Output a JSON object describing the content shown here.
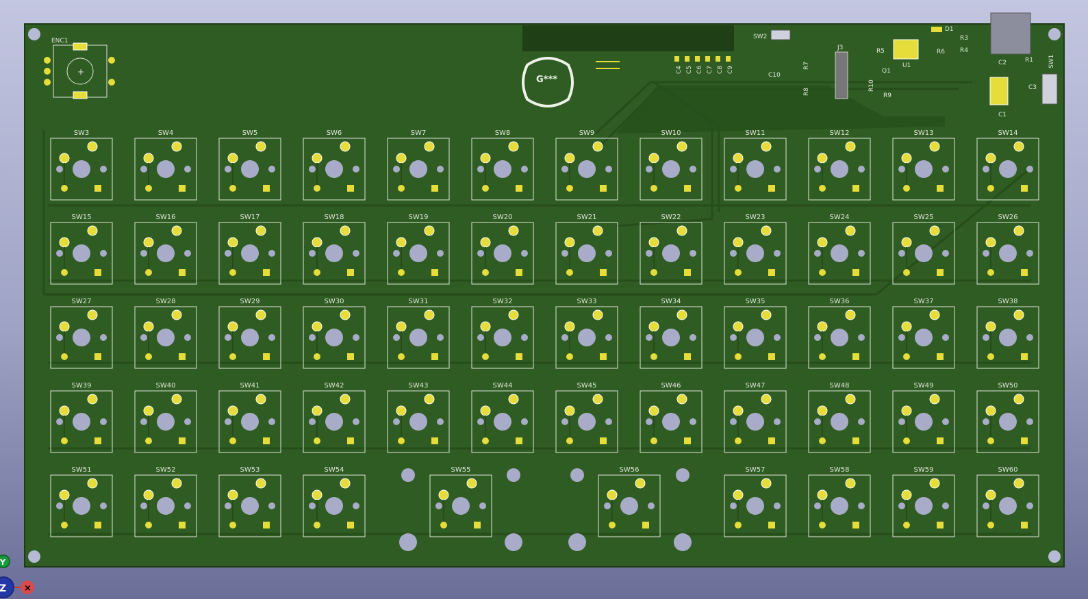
{
  "board": {
    "colors": {
      "board": "#2f5c22",
      "board_edge": "#1e3a16",
      "silk": "#dfe6da",
      "pad": "#e6dc3a",
      "hole": "#a8acc8",
      "trace": "#264d1a"
    },
    "icons": [
      "mounting-hole-icon",
      "axis-gizmo-icon"
    ]
  },
  "components": {
    "enc": "ENC1",
    "logo": "G***",
    "usb": {
      "sw2": "SW2",
      "d1": "D1",
      "r3": "R3",
      "r4": "R4",
      "r1": "R1",
      "r5": "R5",
      "r6": "R6",
      "u1": "U1",
      "j3": "J3",
      "r7": "R7",
      "r8": "R8",
      "r9": "R9",
      "r10": "R10",
      "q1": "Q1",
      "c1": "C1",
      "c2": "C2",
      "c3": "C3",
      "sw1": "SW1",
      "c10": "C10"
    },
    "caps": [
      "C4",
      "C5",
      "C6",
      "C7",
      "C8",
      "C9"
    ]
  },
  "switches": {
    "rows": [
      [
        "SW3",
        "SW4",
        "SW5",
        "SW6",
        "SW7",
        "SW8",
        "SW9",
        "SW10",
        "SW11",
        "SW12",
        "SW13",
        "SW14"
      ],
      [
        "SW15",
        "SW16",
        "SW17",
        "SW18",
        "SW19",
        "SW20",
        "SW21",
        "SW22",
        "SW23",
        "SW24",
        "SW25",
        "SW26"
      ],
      [
        "SW27",
        "SW28",
        "SW29",
        "SW30",
        "SW31",
        "SW32",
        "SW33",
        "SW34",
        "SW35",
        "SW36",
        "SW37",
        "SW38"
      ],
      [
        "SW39",
        "SW40",
        "SW41",
        "SW42",
        "SW43",
        "SW44",
        "SW45",
        "SW46",
        "SW47",
        "SW48",
        "SW49",
        "SW50"
      ]
    ],
    "bottom": [
      "SW51",
      "SW52",
      "SW53",
      "SW54",
      "SW55",
      "SW56",
      "SW57",
      "SW58",
      "SW59",
      "SW60"
    ]
  },
  "axes": {
    "y": "Y",
    "z": "Z",
    "x": "X"
  }
}
